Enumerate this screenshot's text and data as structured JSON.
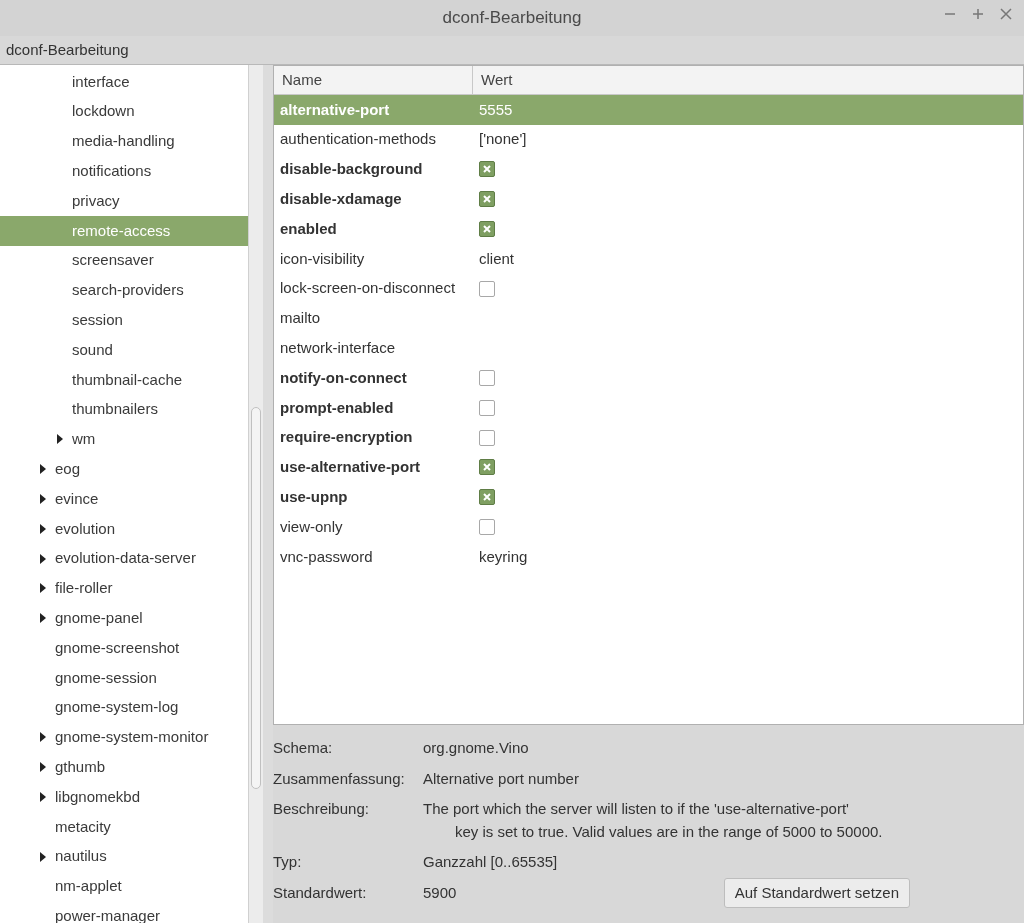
{
  "window": {
    "title": "dconf-Bearbeitung"
  },
  "header": {
    "title": "dconf-Bearbeitung"
  },
  "tree": {
    "items": [
      {
        "children": [
          {
            "label": "interface",
            "has_children": false,
            "selected": false
          },
          {
            "label": "lockdown",
            "has_children": false,
            "selected": false
          },
          {
            "label": "media-handling",
            "has_children": false,
            "selected": false
          },
          {
            "label": "notifications",
            "has_children": false,
            "selected": false
          },
          {
            "label": "privacy",
            "has_children": false,
            "selected": false
          },
          {
            "label": "remote-access",
            "has_children": false,
            "selected": true
          },
          {
            "label": "screensaver",
            "has_children": false,
            "selected": false
          },
          {
            "label": "search-providers",
            "has_children": false,
            "selected": false
          },
          {
            "label": "session",
            "has_children": false,
            "selected": false
          },
          {
            "label": "sound",
            "has_children": false,
            "selected": false
          },
          {
            "label": "thumbnail-cache",
            "has_children": false,
            "selected": false
          },
          {
            "label": "thumbnailers",
            "has_children": false,
            "selected": false
          },
          {
            "label": "wm",
            "has_children": true,
            "selected": false
          }
        ]
      },
      {
        "label": "eog",
        "has_children": true,
        "selected": false
      },
      {
        "label": "evince",
        "has_children": true,
        "selected": false
      },
      {
        "label": "evolution",
        "has_children": true,
        "selected": false
      },
      {
        "label": "evolution-data-server",
        "has_children": true,
        "selected": false
      },
      {
        "label": "file-roller",
        "has_children": true,
        "selected": false
      },
      {
        "label": "gnome-panel",
        "has_children": true,
        "selected": false
      },
      {
        "label": "gnome-screenshot",
        "has_children": false,
        "selected": false
      },
      {
        "label": "gnome-session",
        "has_children": false,
        "selected": false
      },
      {
        "label": "gnome-system-log",
        "has_children": false,
        "selected": false
      },
      {
        "label": "gnome-system-monitor",
        "has_children": true,
        "selected": false
      },
      {
        "label": "gthumb",
        "has_children": true,
        "selected": false
      },
      {
        "label": "libgnomekbd",
        "has_children": true,
        "selected": false
      },
      {
        "label": "metacity",
        "has_children": false,
        "selected": false
      },
      {
        "label": "nautilus",
        "has_children": true,
        "selected": false
      },
      {
        "label": "nm-applet",
        "has_children": false,
        "selected": false
      },
      {
        "label": "power-manager",
        "has_children": false,
        "selected": false
      }
    ]
  },
  "table": {
    "columns": [
      "Name",
      "Wert"
    ],
    "rows": [
      {
        "name": "alternative-port",
        "modified": true,
        "selected": true,
        "kind": "text",
        "value": "5555"
      },
      {
        "name": "authentication-methods",
        "modified": false,
        "selected": false,
        "kind": "text",
        "value": "['none']"
      },
      {
        "name": "disable-background",
        "modified": true,
        "selected": false,
        "kind": "checkbox",
        "checked": true
      },
      {
        "name": "disable-xdamage",
        "modified": true,
        "selected": false,
        "kind": "checkbox",
        "checked": true
      },
      {
        "name": "enabled",
        "modified": true,
        "selected": false,
        "kind": "checkbox",
        "checked": true
      },
      {
        "name": "icon-visibility",
        "modified": false,
        "selected": false,
        "kind": "text",
        "value": "client"
      },
      {
        "name": "lock-screen-on-disconnect",
        "modified": false,
        "selected": false,
        "kind": "checkbox",
        "checked": false
      },
      {
        "name": "mailto",
        "modified": false,
        "selected": false,
        "kind": "text"
      },
      {
        "name": "network-interface",
        "modified": false,
        "selected": false,
        "kind": "text"
      },
      {
        "name": "notify-on-connect",
        "modified": true,
        "selected": false,
        "kind": "checkbox",
        "checked": false
      },
      {
        "name": "prompt-enabled",
        "modified": true,
        "selected": false,
        "kind": "checkbox",
        "checked": false
      },
      {
        "name": "require-encryption",
        "modified": true,
        "selected": false,
        "kind": "checkbox",
        "checked": false
      },
      {
        "name": "use-alternative-port",
        "modified": true,
        "selected": false,
        "kind": "checkbox",
        "checked": true
      },
      {
        "name": "use-upnp",
        "modified": true,
        "selected": false,
        "kind": "checkbox",
        "checked": true
      },
      {
        "name": "view-only",
        "modified": false,
        "selected": false,
        "kind": "checkbox",
        "checked": false
      },
      {
        "name": "vnc-password",
        "modified": false,
        "selected": false,
        "kind": "text",
        "value": "keyring"
      }
    ]
  },
  "details": [
    {
      "label": "Schema:",
      "lines": [
        "org.gnome.Vino"
      ]
    },
    {
      "label": "Zusammenfassung:",
      "lines": [
        "Alternative port number"
      ]
    },
    {
      "label": "Beschreibung:",
      "lines": [
        "The port which the server will listen to if the 'use-alternative-port'",
        "key is set to true. Valid values are in the range of 5000 to 50000."
      ]
    },
    {
      "label": "Typ:",
      "lines": [
        "Ganzzahl [0..65535]"
      ]
    },
    {
      "label": "Standardwert:",
      "lines": [
        "5900"
      ]
    }
  ],
  "reset_button": {
    "label": "Auf Standardwert setzen"
  }
}
